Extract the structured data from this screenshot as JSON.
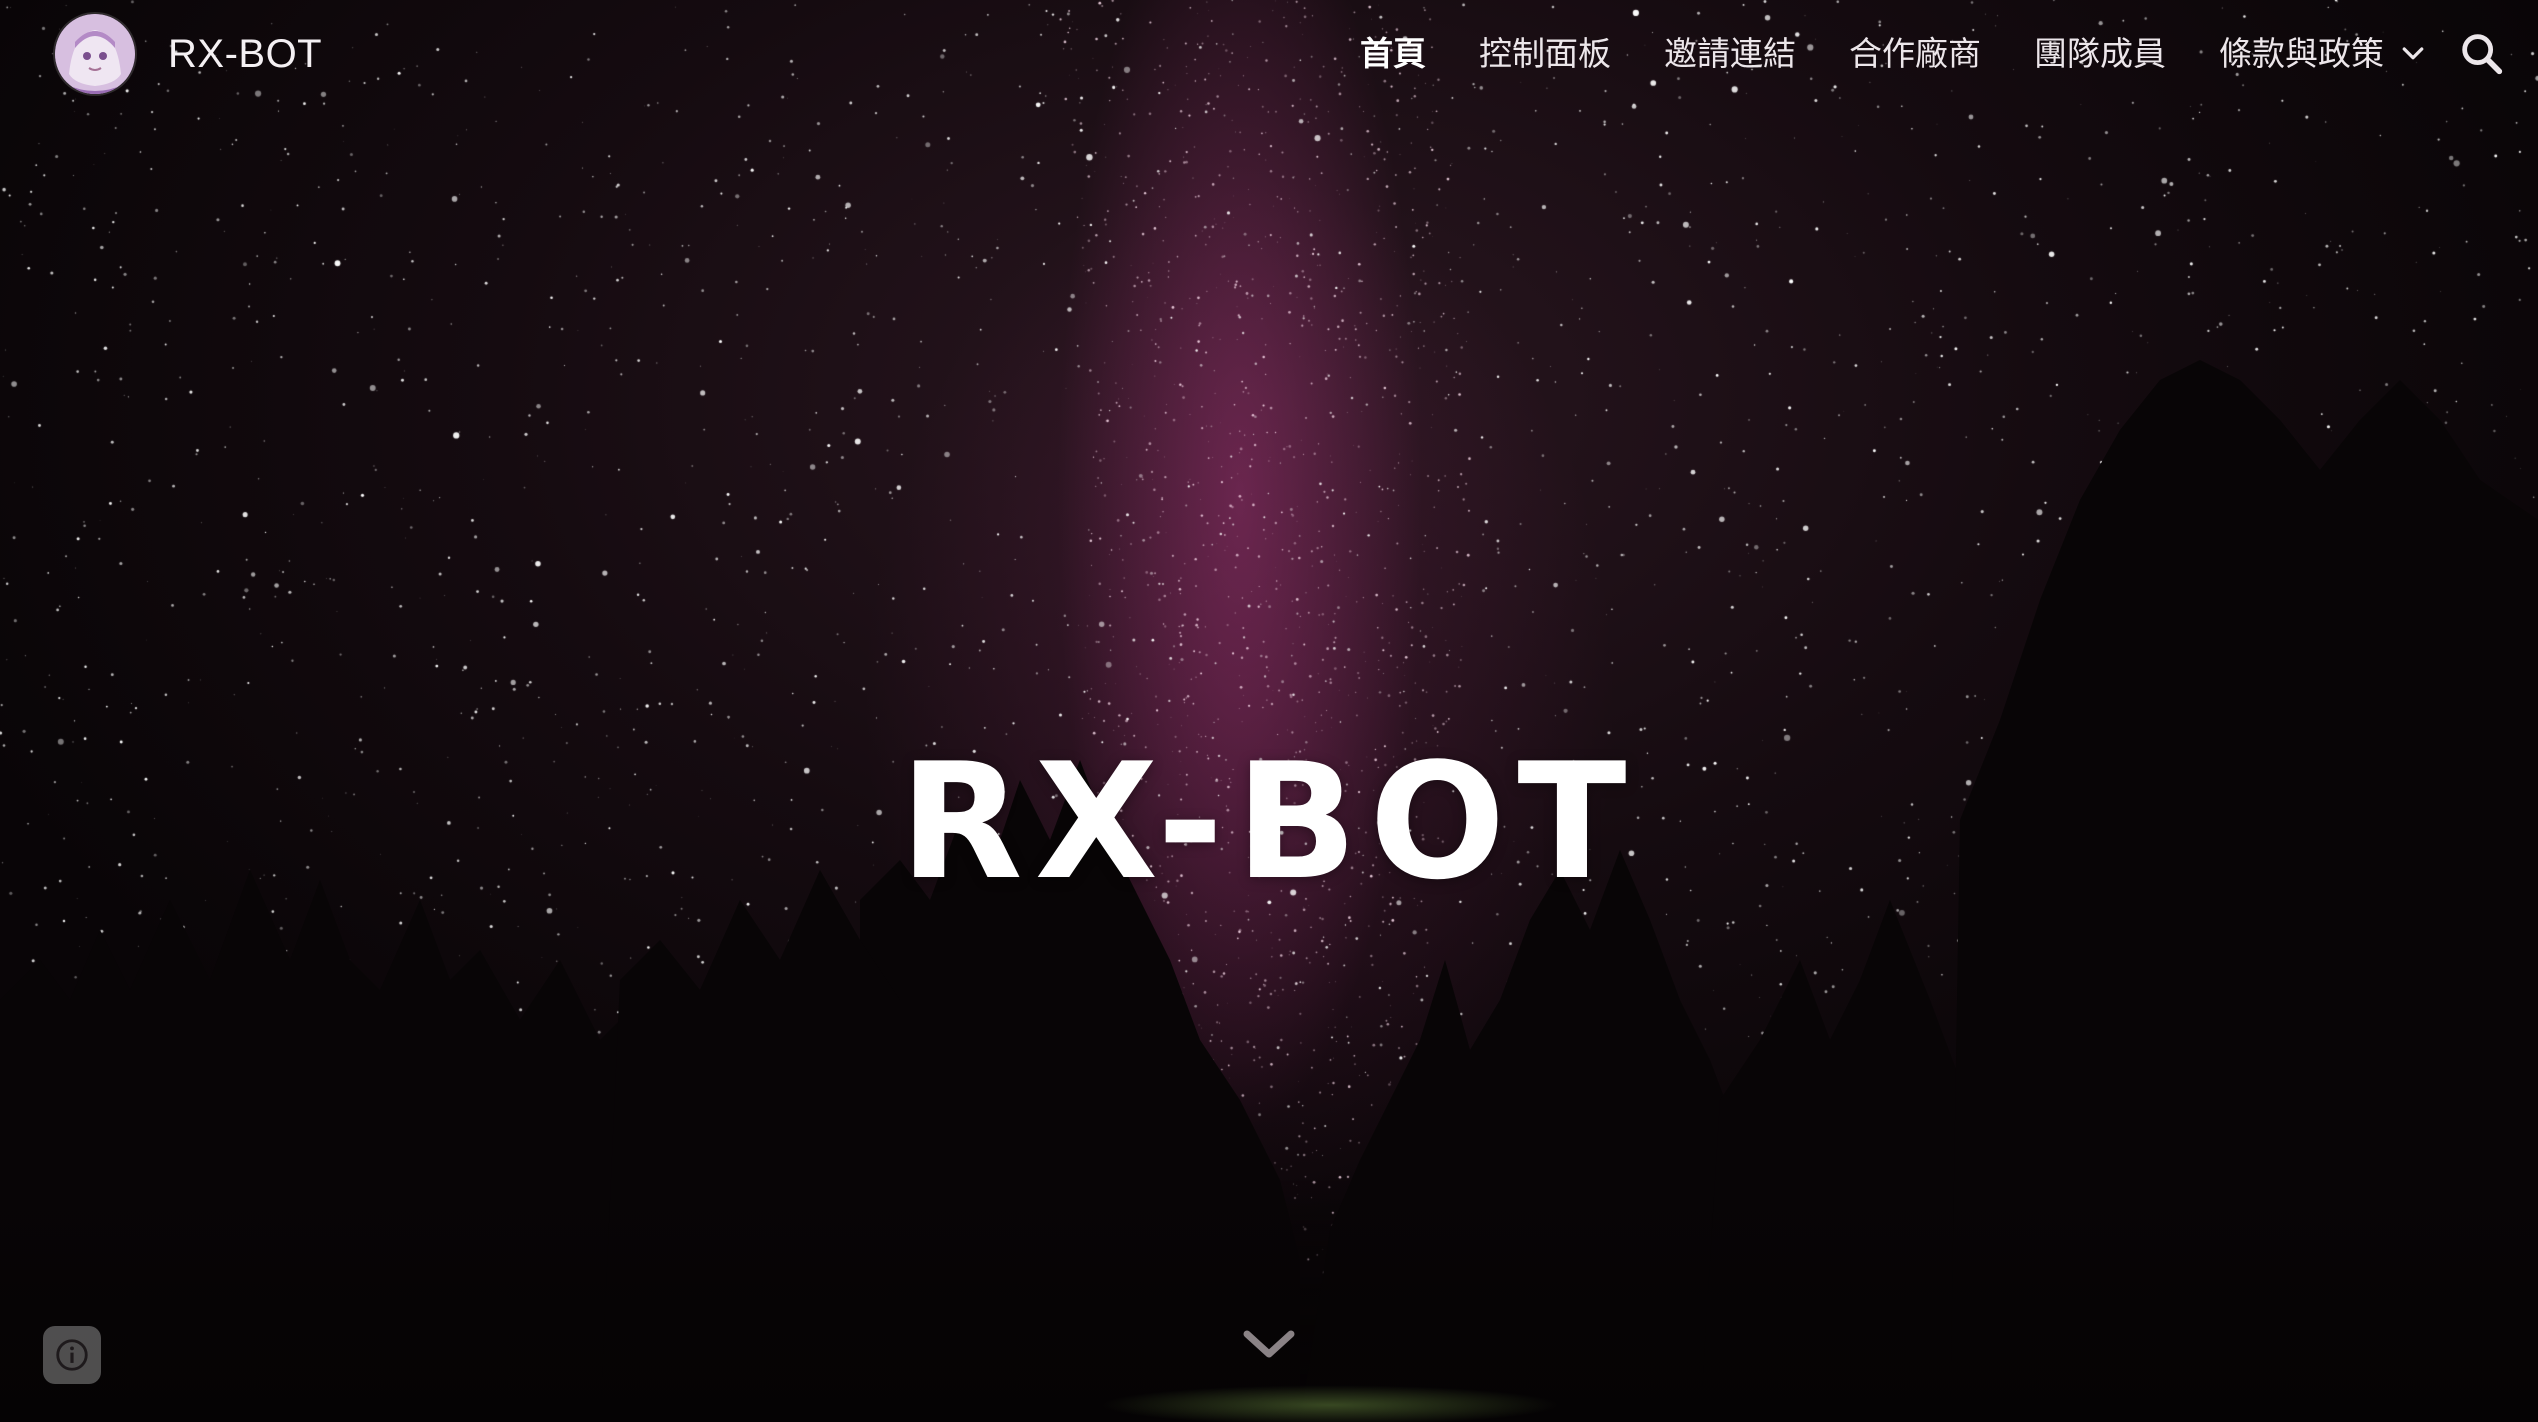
{
  "site": {
    "title": "RX-BOT",
    "logo_icon": "avatar-logo-icon"
  },
  "nav": {
    "items": [
      {
        "label": "首頁",
        "active": true
      },
      {
        "label": "控制面板",
        "active": false
      },
      {
        "label": "邀請連結",
        "active": false
      },
      {
        "label": "合作廠商",
        "active": false
      },
      {
        "label": "團隊成員",
        "active": false
      }
    ],
    "dropdown": {
      "label": "條款與政策",
      "icon": "chevron-down-icon"
    },
    "search_icon": "search-icon"
  },
  "hero": {
    "title": "RX-BOT",
    "scroll_icon": "chevron-down-icon"
  },
  "footer": {
    "info_icon": "info-icon"
  },
  "colors": {
    "text": "#ffffff",
    "sky_dark": "#0b0608",
    "milky_way": "#96326e"
  }
}
